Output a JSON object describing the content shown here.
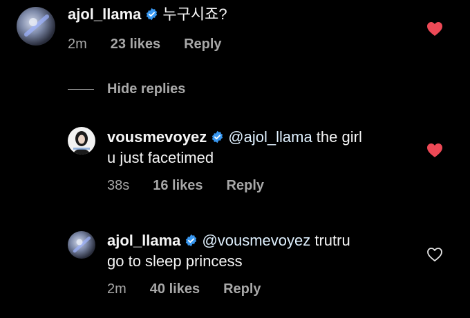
{
  "comments": [
    {
      "username": "ajol_llama",
      "mention": "",
      "text": "누구시죠?",
      "time": "2m",
      "likes": "23 likes",
      "reply": "Reply",
      "liked": true
    },
    {
      "username": "vousmevoyez",
      "mention": "@ajol_llama",
      "text_line1": " the girl",
      "text_line2": "u just facetimed",
      "time": "38s",
      "likes": "16 likes",
      "reply": "Reply",
      "liked": true
    },
    {
      "username": "ajol_llama",
      "mention": "@vousmevoyez",
      "text_line1": " trutru",
      "text_line2": "go to sleep princess",
      "time": "2m",
      "likes": "40 likes",
      "reply": "Reply",
      "liked": false
    }
  ],
  "hide_replies_label": "Hide replies",
  "colors": {
    "background": "#000000",
    "heart_liked": "#ed4956",
    "verified": "#3897f0",
    "meta": "#a8a8a8"
  },
  "icons": [
    "verified-badge-icon",
    "heart-filled-icon",
    "heart-outline-icon"
  ]
}
